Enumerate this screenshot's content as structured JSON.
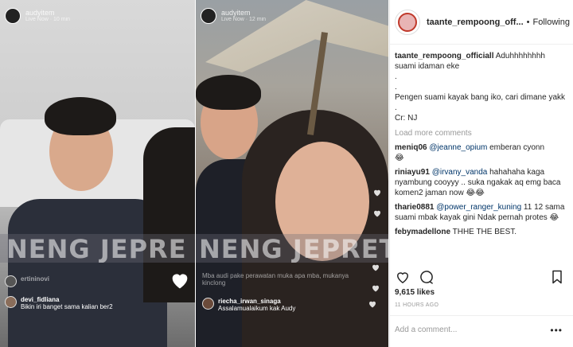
{
  "left_stream": {
    "host_name": "audyitem",
    "host_sub": "Live Now · 10 min",
    "watermark": "NENG JEPRE",
    "comments": [
      {
        "user": "ertininovi",
        "text": "",
        "dim": true
      },
      {
        "user": "devi_fidliana",
        "text": "Bikin iri banget sama kalian ber2",
        "dim": false
      }
    ]
  },
  "mid_stream": {
    "host_name": "audyitem",
    "host_sub": "Live Now · 12 min",
    "watermark": "NENG JEPRET",
    "comments": [
      {
        "user": "",
        "text": "Mba audi pake perawatan muka apa mba, mukanya kinclong",
        "dim": true
      },
      {
        "user": "riecha_irwan_sinaga",
        "text": "Assalamualaikum kak Audy",
        "dim": false
      }
    ]
  },
  "post": {
    "username": "taante_rempoong_off...",
    "separator": "•",
    "follow_state": "Following",
    "caption": {
      "user": "taante_rempoong_officiall",
      "lines": [
        "Aduhhhhhhhh suami idaman eke",
        ".",
        ".",
        "Pengen suami kayak bang iko, cari dimane yakk",
        ".",
        "Cr: NJ"
      ]
    },
    "load_more": "Load more comments",
    "comments": [
      {
        "user": "meniq06",
        "mention": "@jeanne_opium",
        "text": " emberan cyonn",
        "emoji": "😂"
      },
      {
        "user": "riniayu91",
        "mention": "@irvany_vanda",
        "text": " hahahaha kaga nyambung cooyyy .. suka ngakak aq emg baca komen2 jaman now ",
        "emoji": "😂😂"
      },
      {
        "user": "tharie0881",
        "mention": "@power_ranger_kuning",
        "text": " 11 12 sama suami mbak kayak gini Ndak pernah protes ",
        "emoji": "😂"
      },
      {
        "user": "febymadellone",
        "mention": "",
        "text": " THHE THE BEST.",
        "emoji": ""
      }
    ],
    "likes": "9,615 likes",
    "timestamp": "11 HOURS AGO",
    "add_comment_placeholder": "Add a comment...",
    "more_label": "•••"
  },
  "icons": [
    "heart-icon",
    "comment-icon",
    "bookmark-icon",
    "more-icon"
  ],
  "colors": {
    "mention": "#003569",
    "text": "#262626",
    "muted": "#999999"
  }
}
